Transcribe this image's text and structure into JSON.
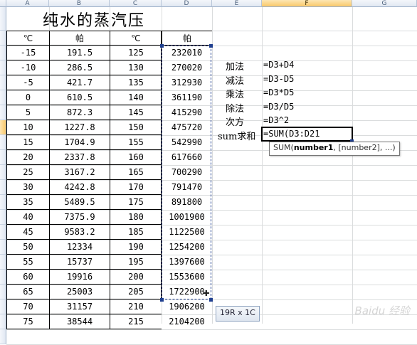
{
  "columns": [
    "A",
    "B",
    "C",
    "D",
    "E",
    "F",
    "G"
  ],
  "title": "纯水的蒸汽压",
  "headers": [
    "℃",
    "帕",
    "℃",
    "帕"
  ],
  "rows": [
    [
      "-15",
      "191.5",
      "125",
      "232010"
    ],
    [
      "-10",
      "286.5",
      "130",
      "270020"
    ],
    [
      "-5",
      "421.7",
      "135",
      "312930"
    ],
    [
      "0",
      "610.5",
      "140",
      "361190"
    ],
    [
      "5",
      "872.3",
      "145",
      "415290"
    ],
    [
      "10",
      "1227.8",
      "150",
      "475720"
    ],
    [
      "15",
      "1704.9",
      "155",
      "542990"
    ],
    [
      "20",
      "2337.8",
      "160",
      "617660"
    ],
    [
      "25",
      "3167.2",
      "165",
      "700290"
    ],
    [
      "30",
      "4242.8",
      "170",
      "791470"
    ],
    [
      "35",
      "5489.5",
      "175",
      "891800"
    ],
    [
      "40",
      "7375.9",
      "180",
      "1001900"
    ],
    [
      "45",
      "9583.2",
      "185",
      "1122500"
    ],
    [
      "50",
      "12334",
      "190",
      "1254200"
    ],
    [
      "55",
      "15737",
      "195",
      "1397600"
    ],
    [
      "60",
      "19916",
      "200",
      "1553600"
    ],
    [
      "65",
      "25003",
      "205",
      "1722900"
    ],
    [
      "70",
      "31157",
      "210",
      "1906200"
    ],
    [
      "75",
      "38544",
      "215",
      "2104200"
    ]
  ],
  "operations": [
    {
      "label": "加法",
      "formula": "=D3+D4"
    },
    {
      "label": "减法",
      "formula": "=D3-D5"
    },
    {
      "label": "乘法",
      "formula": "=D3*D5"
    },
    {
      "label": "除法",
      "formula": "=D3/D5"
    },
    {
      "label": "次方",
      "formula": "=D3^2"
    },
    {
      "label": "sum求和",
      "formula": "=SUM(D3:D21"
    }
  ],
  "tooltip": {
    "fn": "SUM(",
    "arg1": "number1",
    "rest": ", [number2], ...)"
  },
  "range_indicator": "19R x 1C",
  "watermark": "Baidu 经验",
  "colors": {
    "selection": "#1f3f8f",
    "header_highlight": "#f9c86a"
  }
}
